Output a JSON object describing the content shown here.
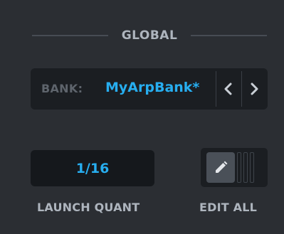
{
  "section": {
    "title": "GLOBAL"
  },
  "bank": {
    "label": "BANK:",
    "name": "MyArpBank*",
    "prev_icon": "chevron-left-icon",
    "next_icon": "chevron-right-icon"
  },
  "launch_quant": {
    "value": "1/16",
    "label": "LAUNCH QUANT"
  },
  "edit_all": {
    "label": "EDIT ALL",
    "icon": "pencil-icon"
  },
  "colors": {
    "background": "#2b2e33",
    "accent": "#27aef0",
    "field_bg": "#1b1e22",
    "label": "#aeb5be",
    "muted": "#5e646c"
  }
}
